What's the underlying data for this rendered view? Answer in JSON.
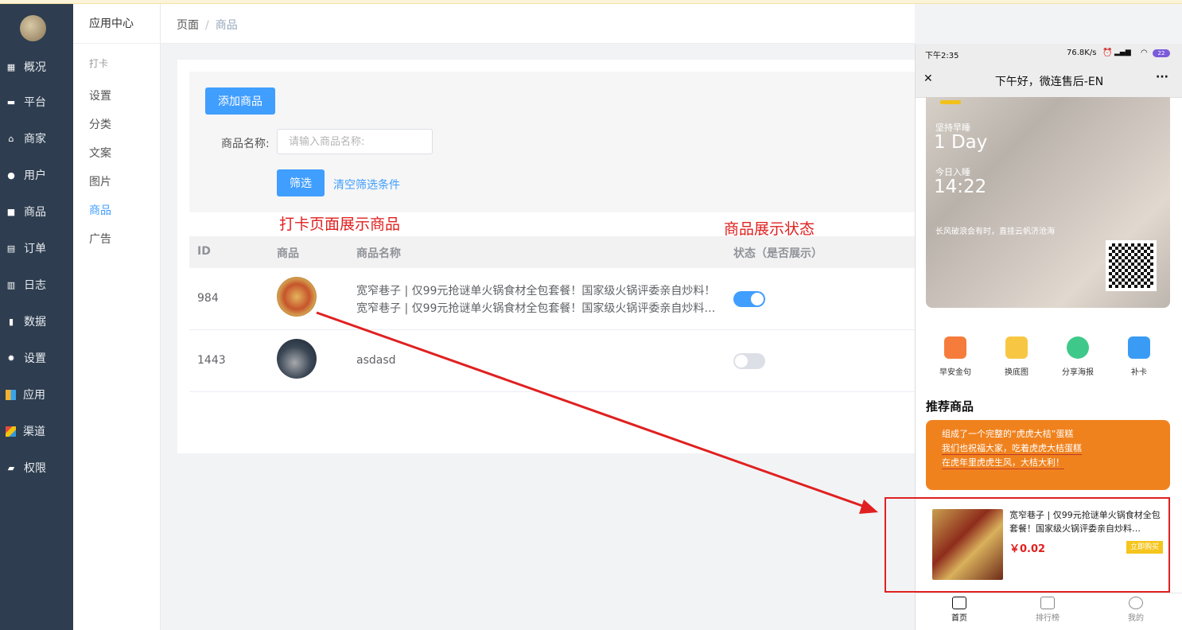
{
  "sidebar": {
    "items": [
      {
        "label": "概况",
        "icon": "chart-icon"
      },
      {
        "label": "平台",
        "icon": "monitor-icon"
      },
      {
        "label": "商家",
        "icon": "store-icon"
      },
      {
        "label": "用户",
        "icon": "user-icon"
      },
      {
        "label": "商品",
        "icon": "bag-icon"
      },
      {
        "label": "订单",
        "icon": "clipboard-icon"
      },
      {
        "label": "日志",
        "icon": "book-icon"
      },
      {
        "label": "数据",
        "icon": "bar-icon"
      },
      {
        "label": "设置",
        "icon": "gear-icon"
      },
      {
        "label": "应用",
        "icon": "apps-icon"
      },
      {
        "label": "渠道",
        "icon": "cube-icon"
      },
      {
        "label": "权限",
        "icon": "lock-icon"
      }
    ]
  },
  "submenu": {
    "title": "应用中心",
    "group": "打卡",
    "items": [
      "设置",
      "分类",
      "文案",
      "图片",
      "商品",
      "广告"
    ],
    "active": "商品"
  },
  "breadcrumb": {
    "root": "页面",
    "separator": "/",
    "current": "商品"
  },
  "toolbar": {
    "add_label": "添加商品"
  },
  "filter": {
    "name_label": "商品名称:",
    "name_placeholder": "请输入商品名称:",
    "filter_label": "筛选",
    "clear_label": "清空筛选条件"
  },
  "annotations": {
    "left": "打卡页面展示商品",
    "right": "商品展示状态"
  },
  "table": {
    "columns": [
      "ID",
      "商品",
      "商品名称",
      "状态（是否展示）"
    ],
    "rows": [
      {
        "id": "984",
        "name_line1": "宽窄巷子 | 仅99元抢谜单火锅食材全包套餐！国家级火锅评委亲自炒料！",
        "name_line2": "宽窄巷子 | 仅99元抢谜单火锅食材全包套餐！国家级火锅评委亲自炒料…",
        "shown": true
      },
      {
        "id": "1443",
        "name_line1": "asdasd",
        "name_line2": "",
        "shown": false
      }
    ]
  },
  "colors": {
    "accent": "#409eff",
    "sidebar": "#2e3d4f",
    "annotation": "#e02020",
    "switch_off": "#dcdfe6"
  },
  "phone": {
    "status": {
      "time": "下午2:35",
      "speed": "76.8K/s",
      "battery": "22"
    },
    "title": "下午好，微连售后-EN",
    "poster": {
      "line1": "坚持早睡",
      "days": "1 Day",
      "line3": "今日入睡",
      "clock": "14:22",
      "line5": "长风破浪会有时，直挂云帆济沧海"
    },
    "tools": [
      {
        "label": "早安金句",
        "color": "#f57c3b"
      },
      {
        "label": "换底图",
        "color": "#f7c744"
      },
      {
        "label": "分享海报",
        "color": "#3ec98b"
      },
      {
        "label": "补卡",
        "color": "#3a9bf4"
      }
    ],
    "recommend_title": "推荐商品",
    "banner_lines": [
      "组成了一个完整的“虎虎大桔”蛋糕",
      "我们也祝福大家，吃着虎虎大桔蛋糕",
      "在虎年里虎虎生风，大桔大利！"
    ],
    "product": {
      "name": "宽窄巷子 | 仅99元抢谜单火锅食材全包套餐！国家级火锅评委亲自炒料…",
      "price": "￥0.02",
      "buy_label": "立即购买"
    },
    "tabs": [
      "首页",
      "排行榜",
      "我的"
    ],
    "close_glyph": "✕",
    "more_glyph": "···"
  }
}
